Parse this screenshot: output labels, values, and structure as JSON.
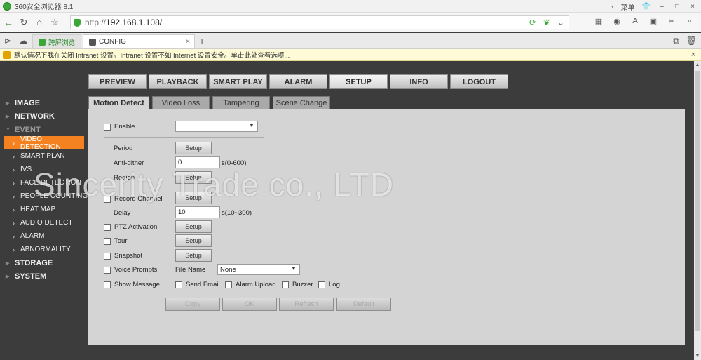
{
  "browser": {
    "title": "360安全浏览器 8.1",
    "title_right": [
      "‹",
      "菜单",
      "👕",
      "–",
      "□",
      "×"
    ],
    "url_prefix": "http://",
    "url_host": "192.168.1.108/",
    "tabs": [
      {
        "label": "跨屏浏览"
      },
      {
        "label": "CONFIG"
      }
    ],
    "new_tab": "+",
    "info_bar": "默认情况下我在关闭 Intranet 设置。Intranet 设置不如 Internet 设置安全。单击此处查看选项...",
    "info_close": "×"
  },
  "top_menu": [
    {
      "label": "PREVIEW",
      "active": false
    },
    {
      "label": "PLAYBACK",
      "active": false
    },
    {
      "label": "SMART PLAY",
      "active": false
    },
    {
      "label": "ALARM",
      "active": false
    },
    {
      "label": "SETUP",
      "active": true
    },
    {
      "label": "INFO",
      "active": false
    },
    {
      "label": "LOGOUT",
      "active": false
    }
  ],
  "side_menu": {
    "groups_top": [
      {
        "label": "IMAGE"
      },
      {
        "label": "NETWORK"
      },
      {
        "label": "EVENT"
      }
    ],
    "event_items": [
      {
        "label": "VIDEO DETECTION"
      },
      {
        "label": "SMART PLAN"
      },
      {
        "label": "IVS"
      },
      {
        "label": "FACE DETECTION"
      },
      {
        "label": "PEOPLE COUNTING"
      },
      {
        "label": "HEAT MAP"
      },
      {
        "label": "AUDIO DETECT"
      },
      {
        "label": "ALARM"
      },
      {
        "label": "ABNORMALITY"
      }
    ],
    "groups_bottom": [
      {
        "label": "STORAGE"
      },
      {
        "label": "SYSTEM"
      }
    ]
  },
  "sub_tabs": [
    {
      "label": "Motion Detect",
      "active": true
    },
    {
      "label": "Video Loss",
      "active": false
    },
    {
      "label": "Tampering",
      "active": false
    },
    {
      "label": "Scene Change",
      "active": false
    }
  ],
  "form": {
    "enable_label": "Enable",
    "enable_value": "",
    "period_label": "Period",
    "anti_dither_label": "Anti-dither",
    "anti_dither_value": "0",
    "anti_dither_unit": "s(0-600)",
    "region_label": "Region",
    "record_channel_label": "Record Channel",
    "delay_label": "Delay",
    "delay_value": "10",
    "delay_unit": "s(10~300)",
    "ptz_label": "PTZ Activation",
    "tour_label": "Tour",
    "snapshot_label": "Snapshot",
    "voice_label": "Voice Prompts",
    "file_name_label": "File Name",
    "file_name_value": "None",
    "show_message_label": "Show Message",
    "send_email_label": "Send Email",
    "alarm_upload_label": "Alarm Upload",
    "buzzer_label": "Buzzer",
    "log_label": "Log",
    "setup_label": "Setup"
  },
  "actions": {
    "copy": "Copy",
    "ok": "OK",
    "refresh": "Refresh",
    "default": "Default"
  },
  "watermark": "Sincerity Trade co., LTD",
  "colors": {
    "active_menu": "#f58220",
    "background": "#3c3c3c",
    "panel": "#d4d4d4"
  }
}
